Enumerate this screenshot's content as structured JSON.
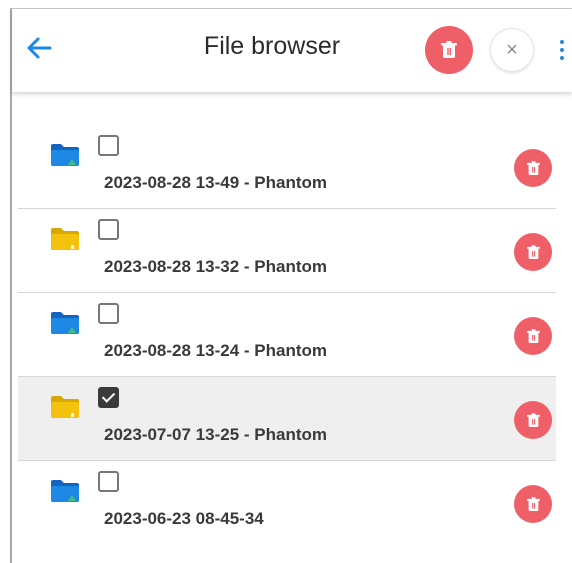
{
  "header": {
    "title": "File browser",
    "back_icon": "arrow-left-icon",
    "delete_icon": "trash-icon",
    "close_icon": "close-icon",
    "close_glyph": "×",
    "more_icon": "more-vertical-icon"
  },
  "colors": {
    "accent_blue": "#1e88e5",
    "delete_red": "#ee5f67",
    "folder_blue": "#1e88e5",
    "folder_yellow": "#f4c20d"
  },
  "items": [
    {
      "name": "2023-08-28 13-49 - Phantom",
      "folder_color": "blue",
      "checked": false
    },
    {
      "name": "2023-08-28 13-32 - Phantom",
      "folder_color": "yellow",
      "checked": false
    },
    {
      "name": "2023-08-28 13-24 - Phantom",
      "folder_color": "blue",
      "checked": false
    },
    {
      "name": "2023-07-07 13-25 - Phantom",
      "folder_color": "yellow",
      "checked": true
    },
    {
      "name": "2023-06-23 08-45-34",
      "folder_color": "blue",
      "checked": false
    }
  ]
}
